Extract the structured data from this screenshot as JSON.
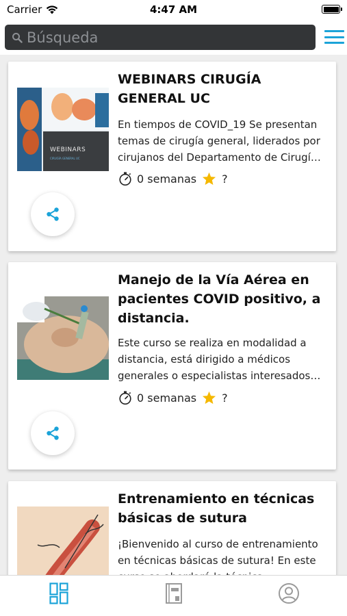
{
  "status_bar": {
    "carrier": "Carrier",
    "time": "4:47 AM"
  },
  "search": {
    "placeholder": "Búsqueda",
    "icon": "search-icon"
  },
  "header": {
    "menu_icon": "hamburger-menu-icon",
    "accent_color": "#1ba3d8"
  },
  "courses": [
    {
      "title": "WEBINARS CIRUGÍA GENERAL UC",
      "description": "En tiempos de COVID_19 Se presentan temas de cirugía general, liderados por cirujanos del Departamento de Cirugía UC",
      "weeks": "0 semanas",
      "rating": "?",
      "thumbnail_label": "WEBINARS",
      "thumbnail_sublabel": "CIRUGÍA GENERAL UC"
    },
    {
      "title": "Manejo de la Vía Aérea en pacientes COVID positivo, a distancia.",
      "description": "Este curso se realiza en modalidad a distancia, está dirigido a médicos generales o especialistas interesados en el manejo de la vía aérea",
      "weeks": "0 semanas",
      "rating": "?"
    },
    {
      "title": "Entrenamiento en técnicas básicas de sutura",
      "description": "¡Bienvenido al curso de entrenamiento en técnicas básicas de sutura! En este curso se abordará la técnica"
    }
  ],
  "tab_bar": {
    "items": [
      "dashboard-icon",
      "book-icon",
      "profile-icon"
    ],
    "active_color": "#1ba3d8",
    "inactive_color": "#9a9a9a"
  },
  "star_color": "#f5b800"
}
